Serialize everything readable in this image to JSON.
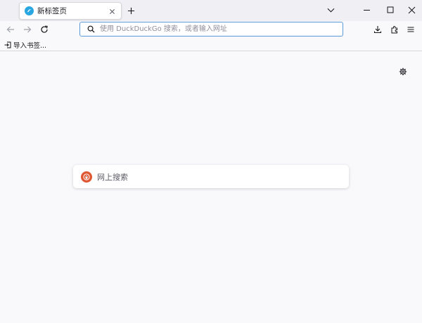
{
  "tab": {
    "title": "新标签页",
    "favicon": "firefox-icon",
    "close": "close-icon"
  },
  "tabstrip": {
    "new_tab": "plus-icon",
    "list_all_tabs": "chevron-down-icon"
  },
  "window_controls": [
    "minimize-icon",
    "maximize-icon",
    "close-icon"
  ],
  "nav": {
    "back": "arrow-left-icon",
    "forward": "arrow-right-icon",
    "reload": "reload-icon"
  },
  "urlbar": {
    "placeholder": "使用 DuckDuckGo 搜索，或者输入网址",
    "value": "",
    "icon": "search-icon"
  },
  "toolbar_right": [
    "download-icon",
    "extensions-icon",
    "menu-icon"
  ],
  "bookmarks_bar": {
    "items": [
      {
        "label": "导入书签...",
        "icon": "import-icon"
      }
    ]
  },
  "newtab": {
    "settings": "gear-icon",
    "search": {
      "placeholder": "网上搜索",
      "engine_icon": "duckduckgo-icon"
    }
  },
  "colors": {
    "accent": "#5b9ad9",
    "tabstrip_bg": "#f0f0f4",
    "page_bg": "#f9f9fb",
    "duckduckgo": "#de5833"
  }
}
